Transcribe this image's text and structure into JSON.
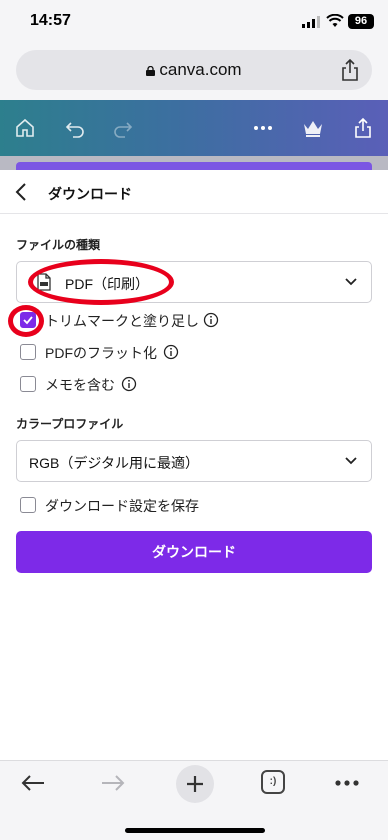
{
  "status_bar": {
    "time": "14:57",
    "battery": "96"
  },
  "browser": {
    "url": "canva.com"
  },
  "download_panel": {
    "title": "ダウンロード",
    "file_type_label": "ファイルの種類",
    "file_type_value": "PDF（印刷）",
    "options": [
      {
        "label": "トリムマークと塗り足し",
        "checked": true,
        "info": true
      },
      {
        "label": "PDFのフラット化",
        "checked": false,
        "info": true
      },
      {
        "label": "メモを含む",
        "checked": false,
        "info": true
      }
    ],
    "color_profile_label": "カラープロファイル",
    "color_profile_value": "RGB（デジタル用に最適）",
    "save_settings_label": "ダウンロード設定を保存",
    "save_settings_checked": false,
    "download_button": "ダウンロード"
  },
  "bottom_bar": {
    "tabs_glyph": ":)"
  },
  "colors": {
    "accent": "#7d2ae8",
    "annotation": "#e8001c"
  }
}
